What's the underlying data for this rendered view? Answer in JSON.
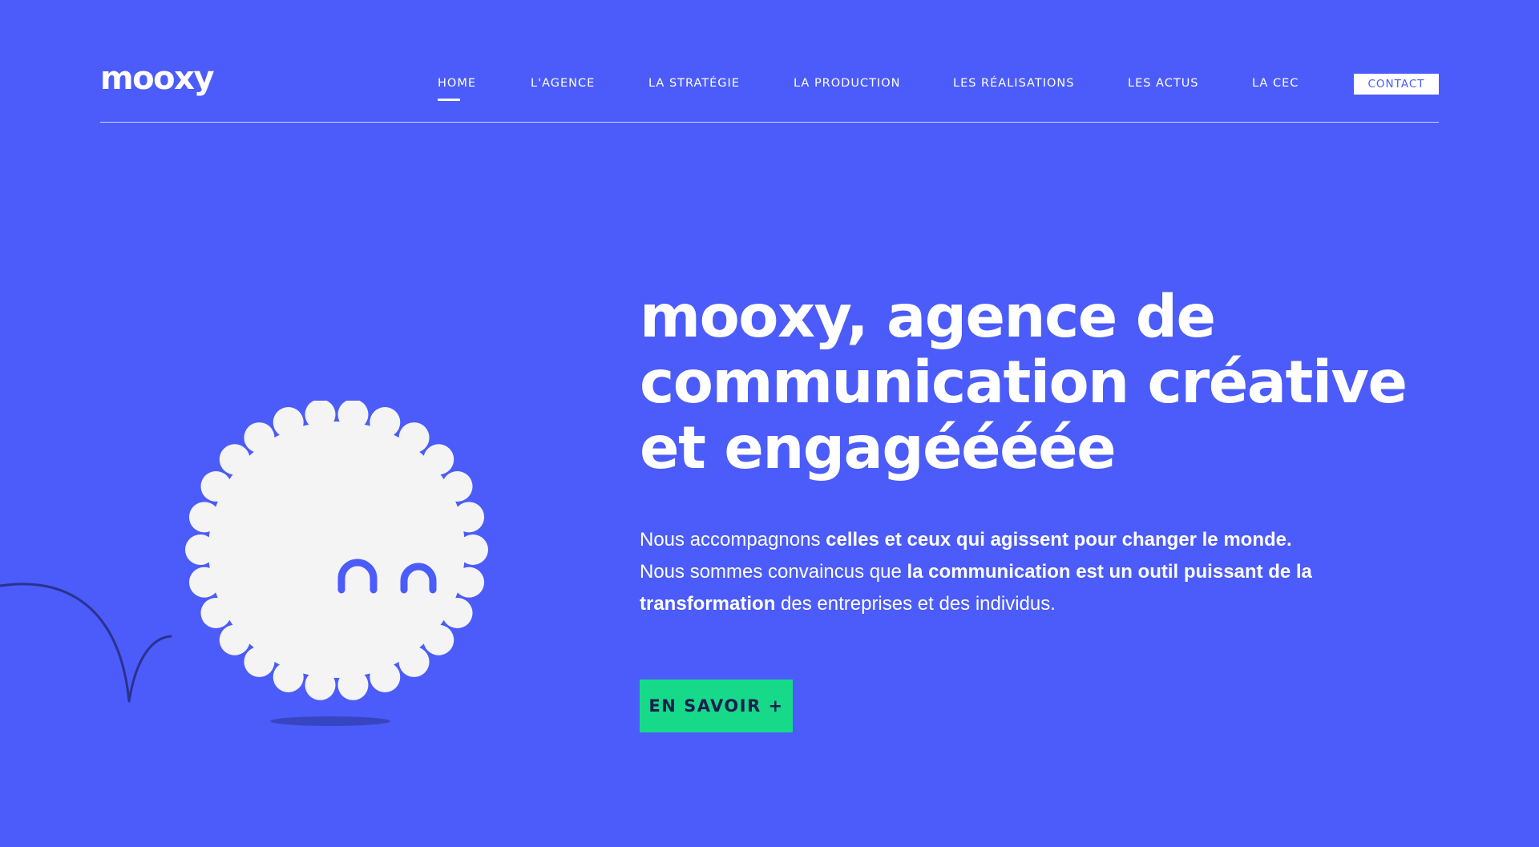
{
  "brand": {
    "logo": "mooxy"
  },
  "nav": {
    "items": [
      {
        "label": "HOME",
        "active": true
      },
      {
        "label": "L'AGENCE",
        "active": false
      },
      {
        "label": "LA STRATÉGIE",
        "active": false
      },
      {
        "label": "LA PRODUCTION",
        "active": false
      },
      {
        "label": "LES RÉALISATIONS",
        "active": false
      },
      {
        "label": "LES ACTUS",
        "active": false
      },
      {
        "label": "LA CEC",
        "active": false
      }
    ],
    "contact_label": "CONTACT"
  },
  "hero": {
    "title_lines": [
      "mooxy, agence de",
      "communication créative",
      "et engagéééée"
    ],
    "description": {
      "p1_plain": "Nous accompagnons ",
      "p1_bold": "celles et ceux qui agissent pour changer le monde.",
      "p2_plain": "Nous sommes convaincus que ",
      "p2_bold": "la communication est un outil puissant de la transformation",
      "p3_plain": " des entreprises et des individus."
    },
    "cta_label": "EN SAVOIR +"
  },
  "colors": {
    "background": "#4b5cfa",
    "accent_green": "#17d98a",
    "mascot_fill": "#f4f4f4",
    "line_dark": "#2a318f"
  },
  "icons": [
    "mascot-icon",
    "jump-trail-icon",
    "shadow-icon"
  ]
}
